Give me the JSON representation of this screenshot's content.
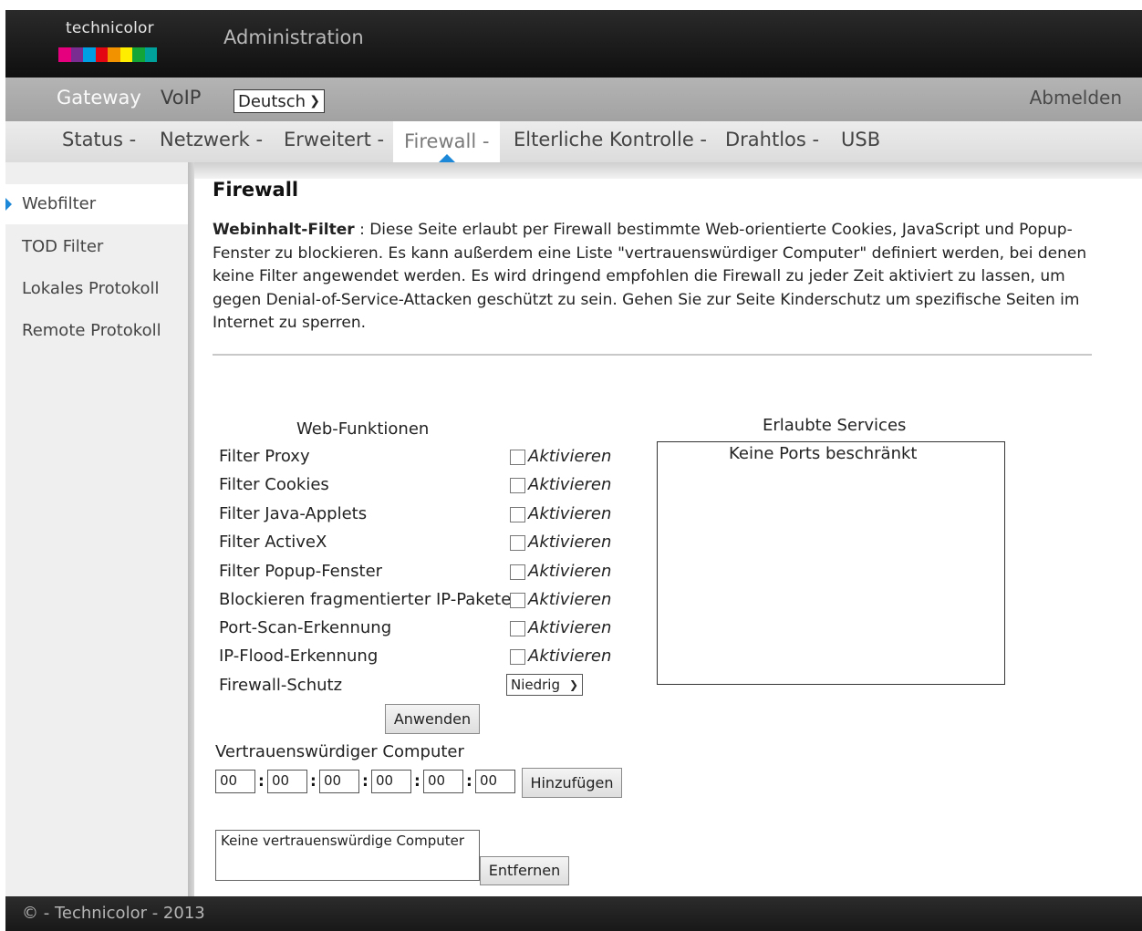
{
  "header": {
    "logo_text": "technicolor",
    "title": "Administration",
    "logo_colors": [
      "#e5007e",
      "#7b2c90",
      "#009fe3",
      "#e30613",
      "#f39200",
      "#ffed00",
      "#13a538",
      "#00a19a"
    ]
  },
  "topnav": {
    "gateway": "Gateway",
    "voip": "VoIP",
    "language": "Deutsch",
    "logout": "Abmelden"
  },
  "subnav": {
    "items": [
      "Status -",
      "Netzwerk -",
      "Erweitert -",
      "Firewall -",
      "Elterliche Kontrolle -",
      "Drahtlos -",
      "USB"
    ],
    "active": "Firewall -"
  },
  "sidebar": {
    "items": [
      "Webfilter",
      "TOD Filter",
      "Lokales Protokoll",
      "Remote Protokoll"
    ],
    "active": "Webfilter"
  },
  "main": {
    "title": "Firewall",
    "desc_label": "Webinhalt-Filter",
    "desc_sep": " : ",
    "description": "Diese Seite erlaubt per Firewall bestimmte Web-orientierte Cookies, JavaScript und Popup-Fenster zu blockieren. Es kann außerdem eine Liste \"vertrauenswürdiger Computer\" definiert werden, bei denen keine Filter angewendet werden. Es wird dringend empfohlen die Firewall zu jeder Zeit aktiviert zu lassen, um gegen Denial-of-Service-Attacken geschützt zu sein. Gehen Sie zur Seite Kinderschutz um spezifische Seiten im Internet zu sperren.",
    "web_functions_heading": "Web-Funktionen",
    "enable_label": "Aktivieren",
    "filters": [
      "Filter Proxy",
      "Filter Cookies",
      "Filter Java-Applets",
      "Filter ActiveX",
      "Filter Popup-Fenster",
      "Blockieren fragmentierter IP-Pakete",
      "Port-Scan-Erkennung",
      "IP-Flood-Erkennung"
    ],
    "firewall_protection_label": "Firewall-Schutz",
    "firewall_protection_value": "Niedrig",
    "apply_button": "Anwenden",
    "trusted_heading": "Vertrauenswürdiger Computer",
    "mac_octets": [
      "00",
      "00",
      "00",
      "00",
      "00",
      "00"
    ],
    "add_button": "Hinzufügen",
    "trusted_list_empty": "Keine vertrauenswürdige Computer",
    "remove_button": "Entfernen",
    "services_heading": "Erlaubte Services",
    "services_empty": "Keine Ports beschränkt"
  },
  "footer": {
    "text": "© - Technicolor - 2013"
  }
}
